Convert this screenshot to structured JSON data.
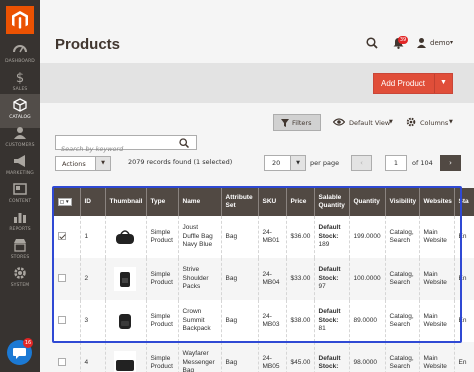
{
  "sidebar": {
    "items": [
      {
        "label": "DASHBOARD",
        "icon": "dashboard-icon"
      },
      {
        "label": "SALES",
        "icon": "dollar-icon"
      },
      {
        "label": "CATALOG",
        "icon": "cube-icon",
        "active": true
      },
      {
        "label": "CUSTOMERS",
        "icon": "customers-icon"
      },
      {
        "label": "MARKETING",
        "icon": "megaphone-icon"
      },
      {
        "label": "CONTENT",
        "icon": "content-icon"
      },
      {
        "label": "REPORTS",
        "icon": "bar-chart-icon"
      },
      {
        "label": "STORES",
        "icon": "store-icon"
      },
      {
        "label": "SYSTEM",
        "icon": "gear-icon"
      }
    ]
  },
  "header": {
    "title": "Products",
    "notifications_count": "39",
    "user_name": "demo"
  },
  "actions_bar": {
    "add_product": "Add Product"
  },
  "toolbar": {
    "filters": "Filters",
    "view": "Default View",
    "columns": "Columns",
    "search_placeholder": "Search by keyword",
    "actions": "Actions",
    "records": "2079 records found (1 selected)",
    "per_page": "20",
    "per_page_label": "per page",
    "page": "1",
    "page_of": "of 104"
  },
  "grid": {
    "columns": [
      "ID",
      "Thumbnail",
      "Type",
      "Name",
      "Attribute Set",
      "SKU",
      "Price",
      "Salable Quantity",
      "Quantity",
      "Visibility",
      "Websites",
      "Sta"
    ],
    "rows": [
      {
        "checked": true,
        "id": "1",
        "type": "Simple Product",
        "name": "Joust Duffle Bag Navy Blue",
        "attr": "Bag",
        "sku": "24-MB01",
        "price": "$36.00",
        "salable_label": "Default Stock:",
        "salable_value": "189",
        "qty": "199.0000",
        "visibility": "Catalog, Search",
        "websites": "Main Website",
        "status": "En"
      },
      {
        "checked": false,
        "id": "2",
        "type": "Simple Product",
        "name": "Strive Shoulder Packs",
        "attr": "Bag",
        "sku": "24-MB04",
        "price": "$33.00",
        "salable_label": "Default Stock:",
        "salable_value": "97",
        "qty": "100.0000",
        "visibility": "Catalog, Search",
        "websites": "Main Website",
        "status": "En"
      },
      {
        "checked": false,
        "id": "3",
        "type": "Simple Product",
        "name": "Crown Summit Backpack",
        "attr": "Bag",
        "sku": "24-MB03",
        "price": "$38.00",
        "salable_label": "Default Stock:",
        "salable_value": "81",
        "qty": "89.0000",
        "visibility": "Catalog, Search",
        "websites": "Main Website",
        "status": "En"
      },
      {
        "checked": false,
        "id": "4",
        "type": "Simple Product",
        "name": "Wayfarer Messenger Bag",
        "attr": "Bag",
        "sku": "24-MB05",
        "price": "$45.00",
        "salable_label": "Default Stock:",
        "salable_value": "",
        "qty": "98.0000",
        "visibility": "Catalog, Search",
        "websites": "Main Website",
        "status": "En"
      }
    ]
  },
  "chat": {
    "badge": "16"
  },
  "colors": {
    "sidebar": "#373330",
    "accent": "#eb5202",
    "add_button": "#e04e39",
    "grid_header": "#514943",
    "highlight": "#2f49d4"
  }
}
